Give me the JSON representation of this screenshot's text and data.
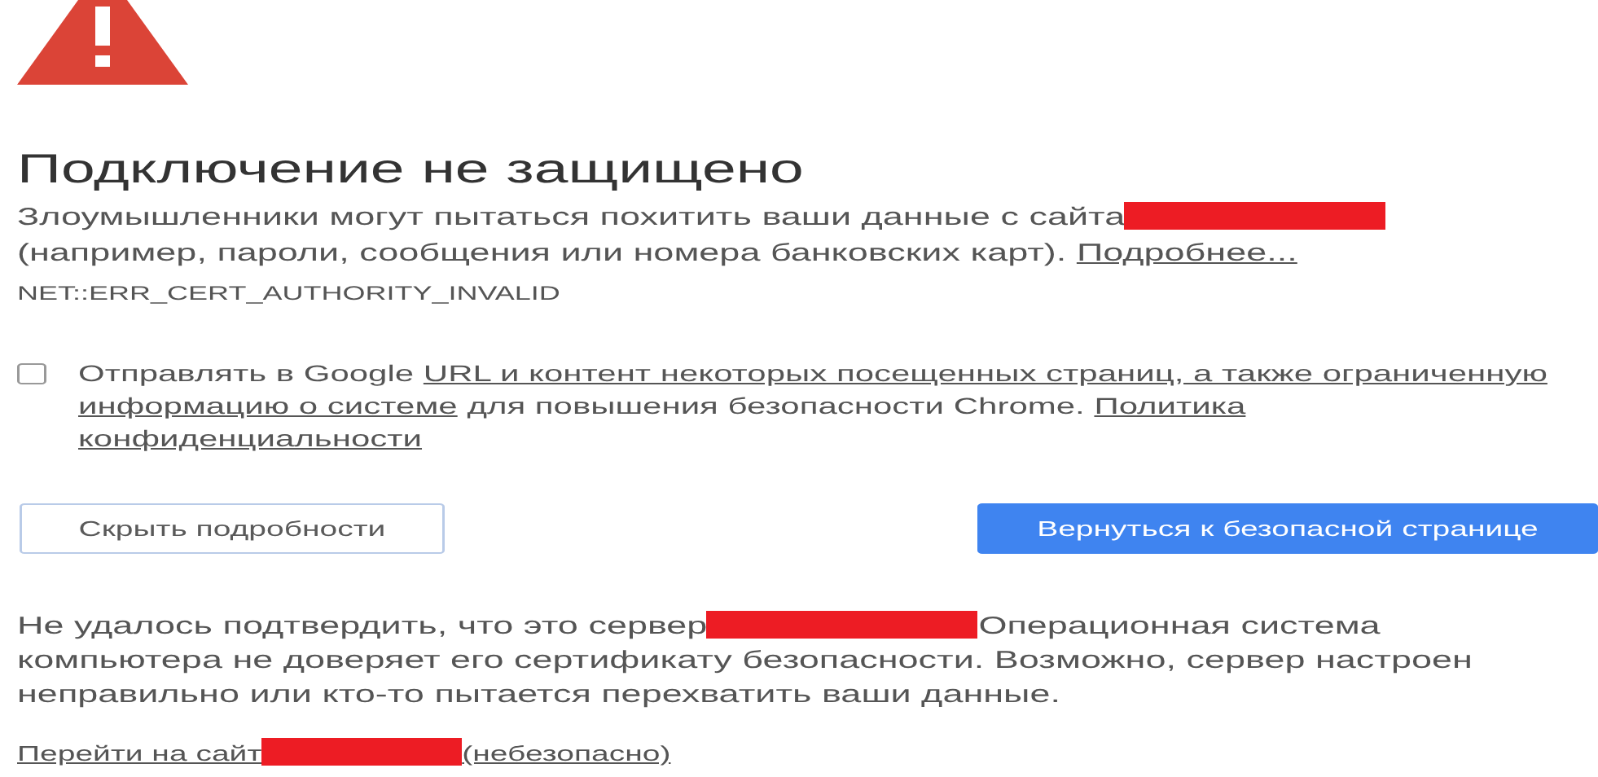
{
  "heading": "Подключение не защищено",
  "intro": {
    "text_before": "Злоумышленники могут пытаться похитить ваши данные с сайта",
    "redacted": true,
    "text_after": "(например, пароли, сообщения или номера банковских карт).",
    "link": "Подробнее..."
  },
  "error_code": "NET::ERR_CERT_AUTHORITY_INVALID",
  "opt_in": {
    "checked": false,
    "lines": [
      [
        {
          "kind": "text",
          "text": "Отправлять в Google"
        },
        {
          "kind": "link",
          "text": "URL и контент некоторых посещенных страниц, а также ограниченную"
        }
      ],
      [
        {
          "kind": "link",
          "text": "информацию о системе"
        },
        {
          "kind": "text",
          "text": "для повышения безопасности Chrome."
        },
        {
          "kind": "link",
          "text": "Политика"
        }
      ],
      [
        {
          "kind": "link",
          "text": "конфиденциальности"
        }
      ]
    ]
  },
  "buttons": [
    {
      "kind": "secondary",
      "label": "Скрыть подробности"
    },
    {
      "kind": "primary",
      "label": "Вернуться к безопасной странице"
    }
  ],
  "details": {
    "text_before": "Не удалось подтвердить, что это сервер",
    "redacted": true,
    "text_after": "Операционная система компьютера не доверяет его сертификату безопасности. Возможно, сервер настроен неправильно или кто-то пытается перехватить ваши данные."
  },
  "proceed": {
    "text_before": "Перейти на сайт",
    "redacted": true,
    "text_after": "(небезопасно)"
  }
}
